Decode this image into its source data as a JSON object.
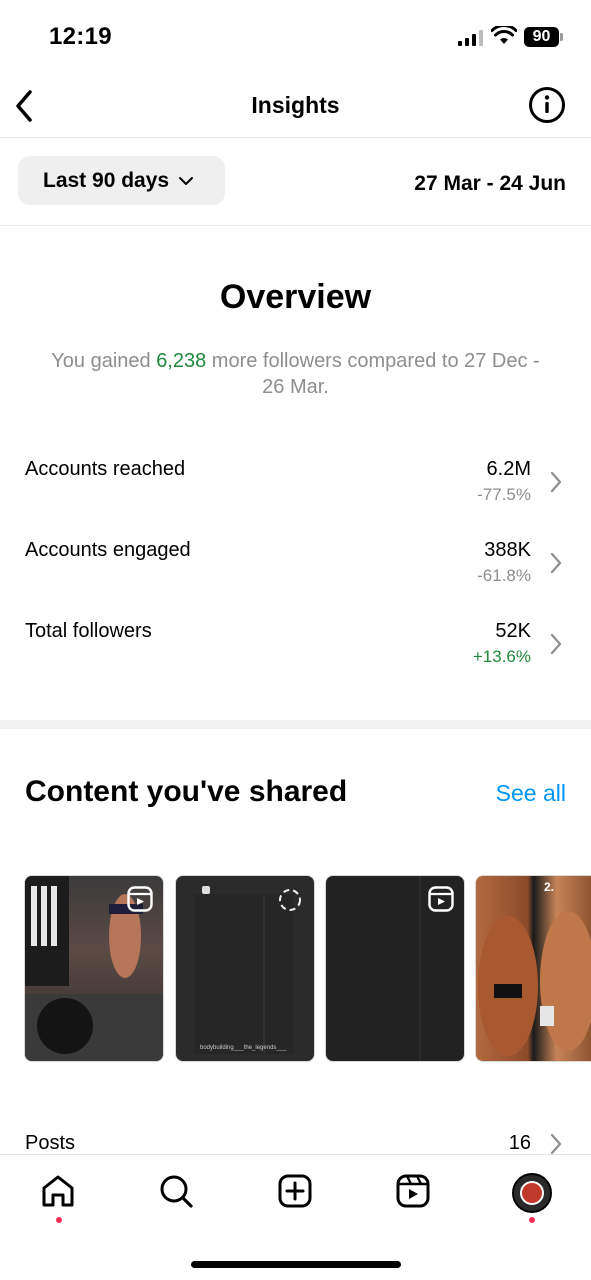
{
  "status_bar": {
    "time": "12:19",
    "battery": "90"
  },
  "header": {
    "title": "Insights"
  },
  "filter": {
    "range_label": "Last 90 days",
    "date_range": "27 Mar - 24 Jun"
  },
  "overview": {
    "title": "Overview",
    "summary_prefix": "You gained ",
    "summary_number": "6,238",
    "summary_suffix": " more followers compared to 27 Dec - 26 Mar.",
    "metrics": [
      {
        "label": "Accounts reached",
        "value": "6.2M",
        "change": "-77.5%",
        "trend": "negative"
      },
      {
        "label": "Accounts engaged",
        "value": "388K",
        "change": "-61.8%",
        "trend": "negative"
      },
      {
        "label": "Total followers",
        "value": "52K",
        "change": "+13.6%",
        "trend": "positive"
      }
    ]
  },
  "content_shared": {
    "title": "Content you've shared",
    "see_all": "See all",
    "thumbnails": [
      {
        "type": "reel",
        "caption": ""
      },
      {
        "type": "reel",
        "caption": "bodybuilding___the_legends___"
      },
      {
        "type": "reel",
        "caption": ""
      },
      {
        "type": "post",
        "caption": "2."
      }
    ]
  },
  "posts": {
    "label": "Posts",
    "count": "16"
  },
  "tab_bar": {
    "items": [
      "home-icon",
      "search-icon",
      "create-icon",
      "reels-icon",
      "profile-avatar"
    ]
  },
  "colors": {
    "accent": "#0095f6",
    "positive": "#1f8a3b",
    "muted": "#8e8e8e",
    "notification_dot": "#ff2d55"
  }
}
